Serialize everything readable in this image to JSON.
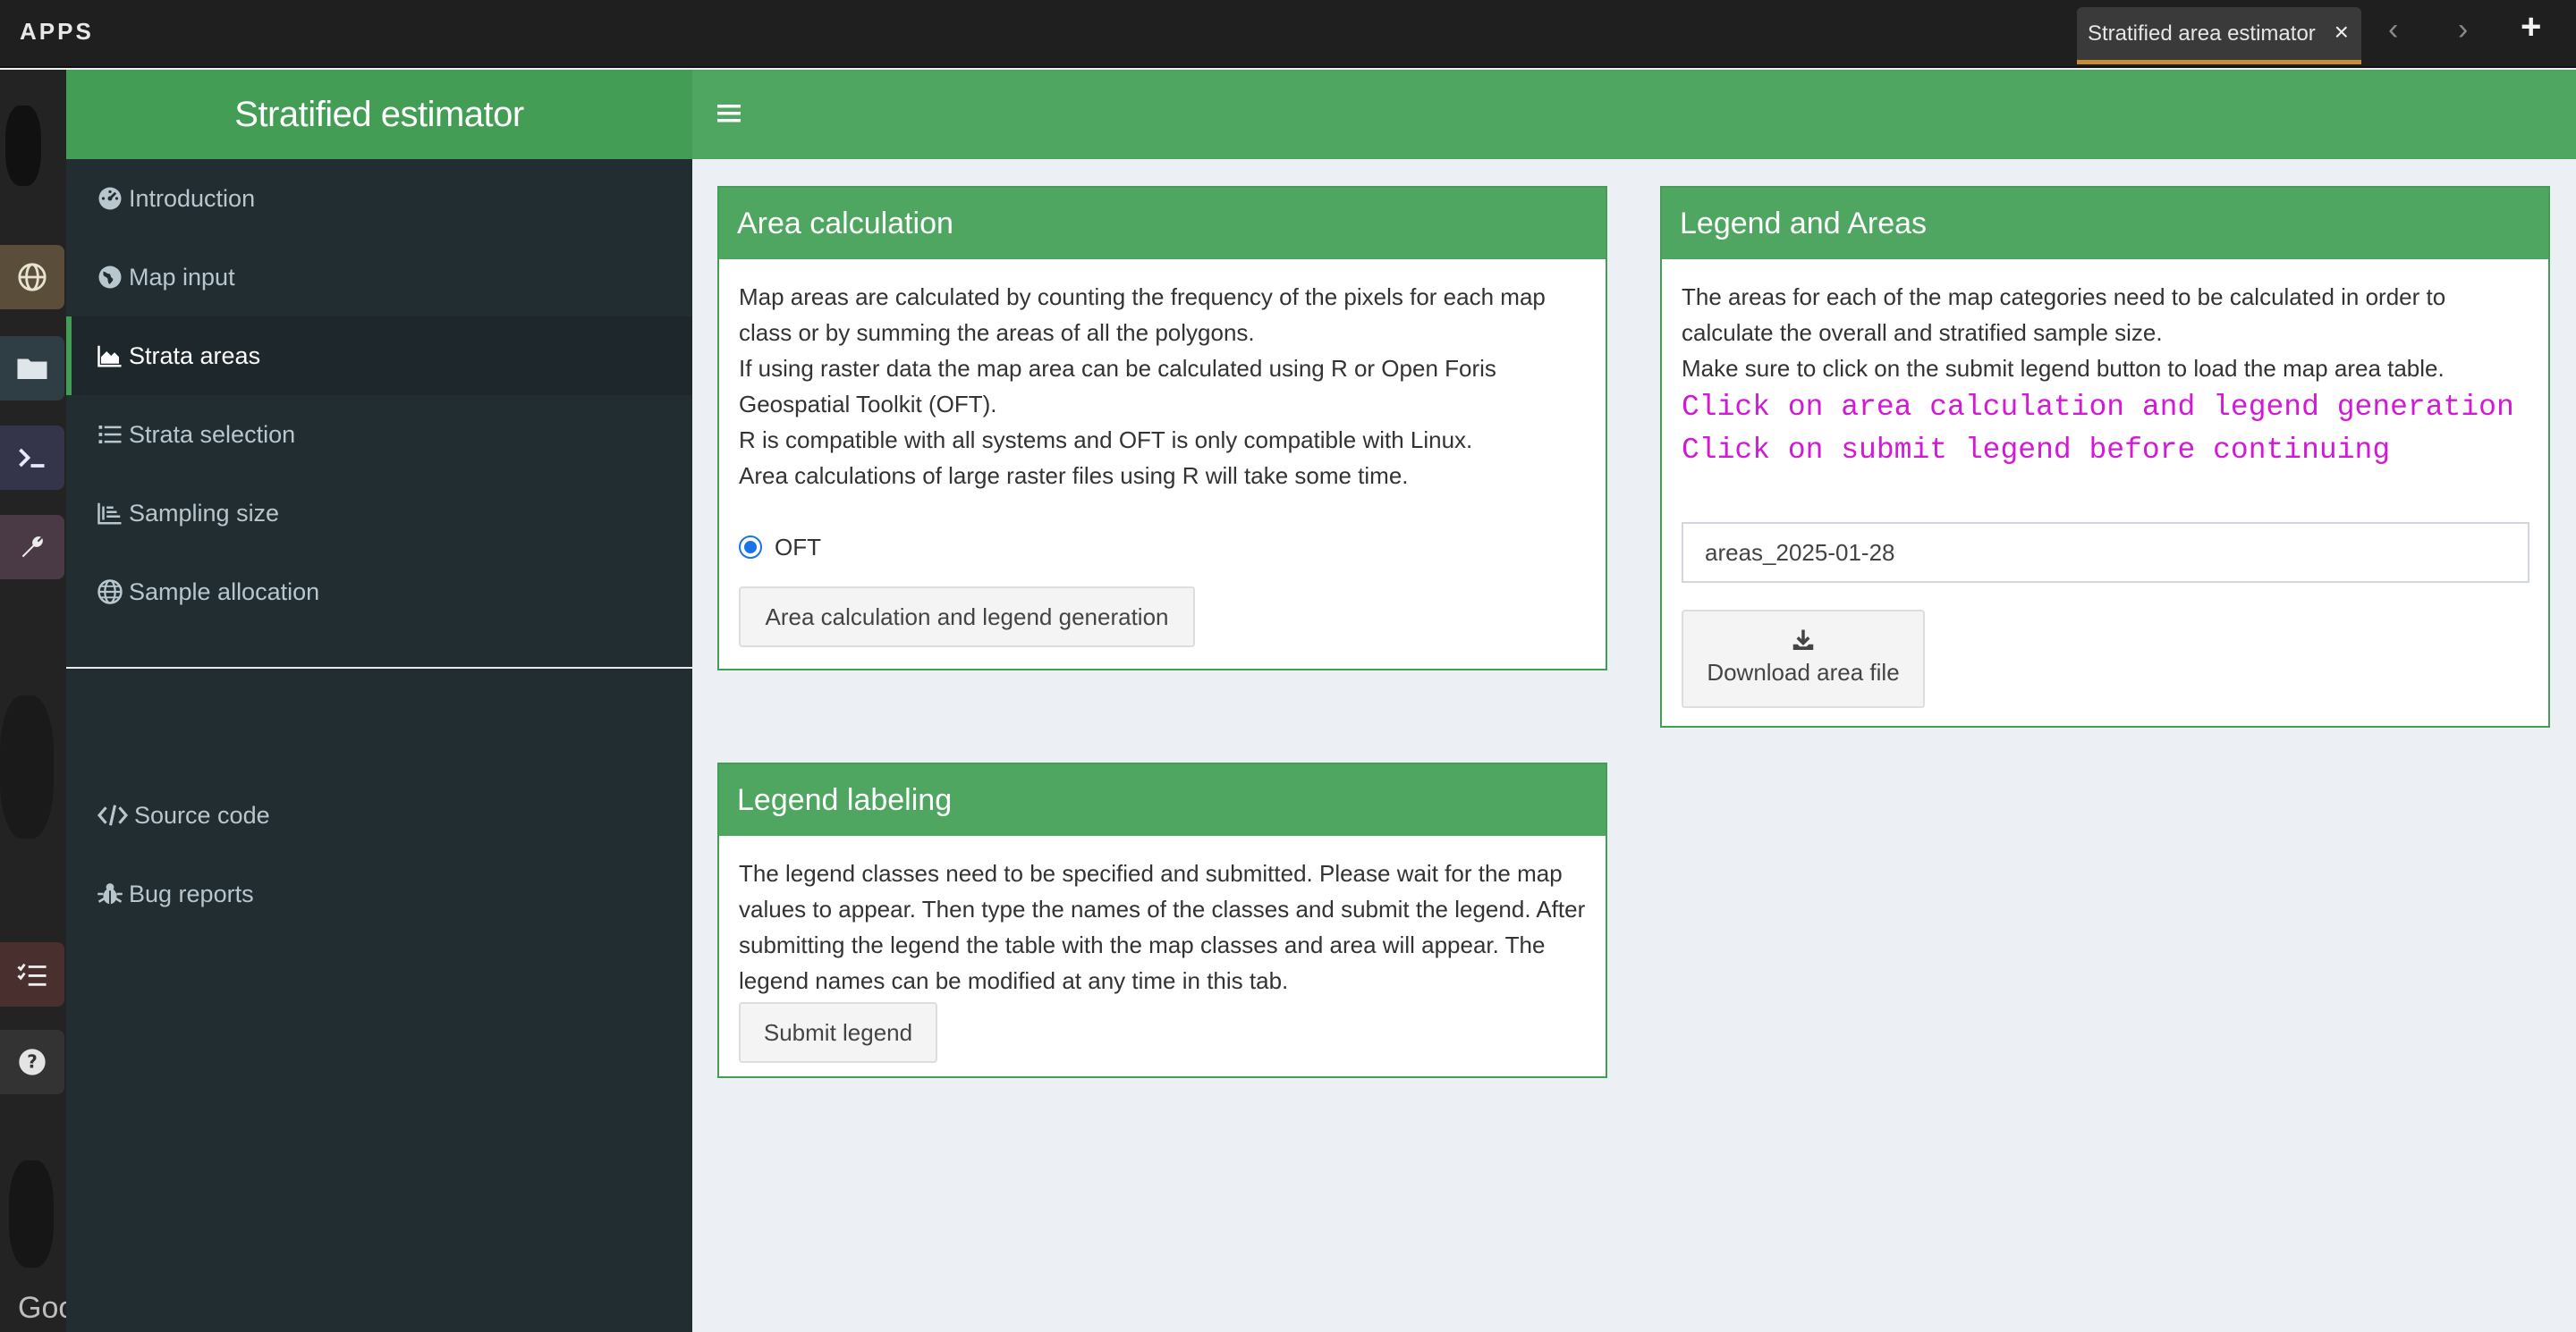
{
  "topbar": {
    "apps_label": "APPS",
    "tab_title": "Stratified area estimator",
    "close_symbol": "×",
    "back_symbol": "‹",
    "forward_symbol": "›",
    "new_tab_symbol": "+"
  },
  "dock": {
    "icons": [
      "globe-icon",
      "folder-icon",
      "terminal-icon",
      "wrench-icon",
      "task-list-icon",
      "help-icon"
    ],
    "map_attribution": "Goo"
  },
  "sidebar": {
    "title": "Stratified estimator",
    "items": [
      {
        "label": "Introduction",
        "icon": "dashboard-icon"
      },
      {
        "label": "Map input",
        "icon": "globe-americas-icon"
      },
      {
        "label": "Strata areas",
        "icon": "area-chart-icon"
      },
      {
        "label": "Strata selection",
        "icon": "list-icon"
      },
      {
        "label": "Sampling size",
        "icon": "bar-chart-icon"
      },
      {
        "label": "Sample allocation",
        "icon": "globe-grid-icon"
      }
    ],
    "footer_items": [
      {
        "label": "Source code",
        "icon": "code-icon"
      },
      {
        "label": "Bug reports",
        "icon": "bug-icon"
      }
    ]
  },
  "area_calc": {
    "title": "Area calculation",
    "lines": [
      "Map areas are calculated by counting the frequency of the pixels for each map class or by summing the areas of all the polygons.",
      "If using raster data the map area can be calculated using R or Open Foris Geospatial Toolkit (OFT).",
      "R is compatible with all systems and OFT is only compatible with Linux.",
      "Area calculations of large raster files using R will take some time."
    ],
    "radio_label": "OFT",
    "button_label": "Area calculation and legend generation"
  },
  "legend_areas": {
    "title": "Legend and Areas",
    "lines": [
      "The areas for each of the map categories need to be calculated in order to calculate the overall and stratified sample size.",
      "Make sure to click on the submit legend button to load the map area table."
    ],
    "hints": [
      "Click on area calculation and legend generation",
      "Click on submit legend before continuing"
    ],
    "filename_value": "areas_2025-01-28",
    "download_label": "Download area file"
  },
  "legend_labeling": {
    "title": "Legend labeling",
    "text": "The legend classes need to be specified and submitted. Please wait for the map values to appear. Then type the names of the classes and submit the legend. After submitting the legend the table with the map classes and area will appear. The legend names can be modified at any time in this tab.",
    "button_label": "Submit legend"
  },
  "colors": {
    "brand_green": "#4ea660",
    "sidebar_bg": "#222d32",
    "hint_magenta": "#d21ad6"
  }
}
